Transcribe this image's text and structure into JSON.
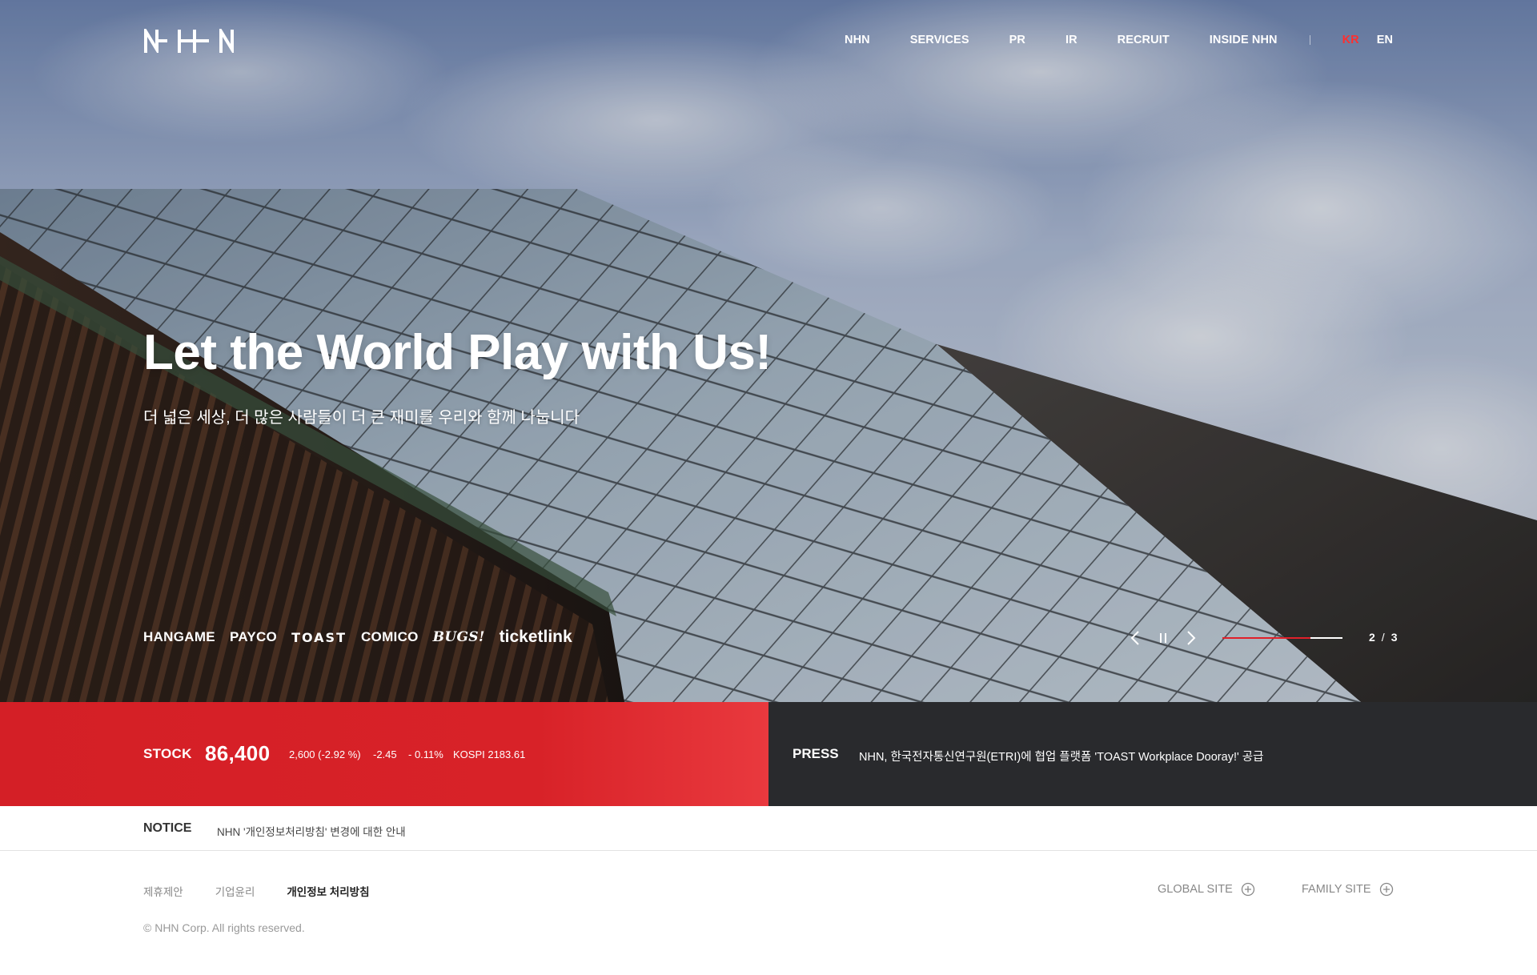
{
  "header": {
    "nav": [
      "NHN",
      "SERVICES",
      "PR",
      "IR",
      "RECRUIT",
      "INSIDE NHN"
    ],
    "languages": {
      "kr": "KR",
      "en": "EN",
      "active": "KR"
    }
  },
  "hero": {
    "headline": "Let the World Play with Us!",
    "subline": "더 넓은 세상, 더 많은 사람들이 더 큰 재미를 우리와 함께 나눕니다",
    "services": [
      "HANGAME",
      "PAYCO",
      "TOAST",
      "COMICO",
      "BUGS!",
      "ticketlink"
    ],
    "slider": {
      "current": "2",
      "total": "3",
      "progress": 0.73
    }
  },
  "stock": {
    "label": "STOCK",
    "price": "86,400",
    "change": "2,600 (-2.92 %)",
    "index_change": "-2.45",
    "index_rate": "- 0.11%",
    "kospi": "KOSPI 2183.61"
  },
  "press": {
    "label": "PRESS",
    "title": "NHN, 한국전자통신연구원(ETRI)에 협업 플랫폼 'TOAST Workplace Dooray!' 공급"
  },
  "notice": {
    "label": "NOTICE",
    "text": "NHN '개인정보처리방침' 변경에 대한 안내"
  },
  "footer": {
    "links": [
      "제휴제안",
      "기업윤리",
      "개인정보 처리방침"
    ],
    "copyright": "© NHN Corp. All rights reserved.",
    "global_site": "GLOBAL SITE",
    "family_site": "FAMILY SITE"
  },
  "colors": {
    "accent_red": "#d41f26",
    "press_dark": "#292a2d",
    "active_lang": "#ff2f2f"
  }
}
